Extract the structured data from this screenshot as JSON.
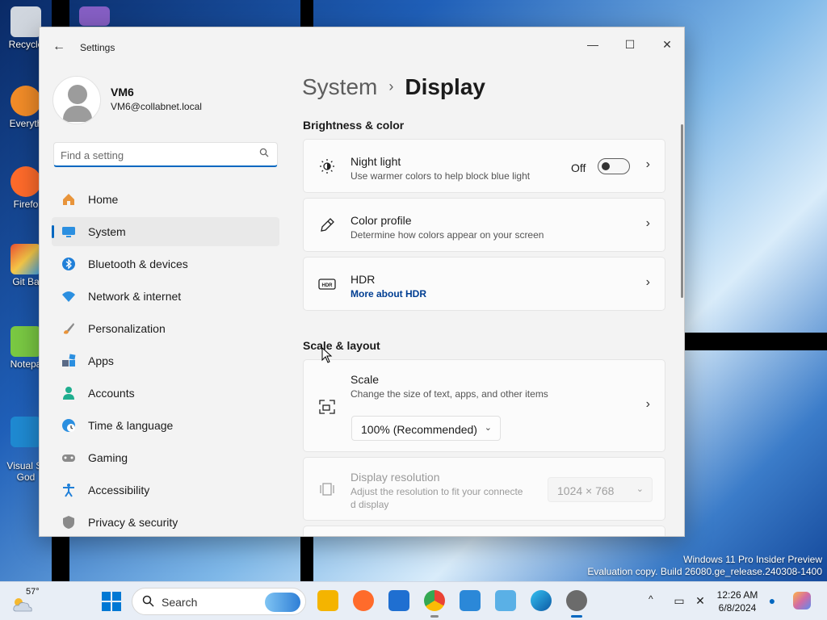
{
  "window": {
    "title": "Settings",
    "back_glyph": "←",
    "minimize_glyph": "—",
    "maximize_glyph": "☐",
    "close_glyph": "✕"
  },
  "profile": {
    "name": "VM6",
    "email": "VM6@collabnet.local"
  },
  "search": {
    "placeholder": "Find a setting",
    "icon": "search-icon"
  },
  "nav": {
    "items": [
      {
        "label": "Home",
        "icon": "home-icon"
      },
      {
        "label": "System",
        "icon": "system-icon",
        "active": true
      },
      {
        "label": "Bluetooth & devices",
        "icon": "bluetooth-icon"
      },
      {
        "label": "Network & internet",
        "icon": "wifi-icon"
      },
      {
        "label": "Personalization",
        "icon": "brush-icon"
      },
      {
        "label": "Apps",
        "icon": "apps-icon"
      },
      {
        "label": "Accounts",
        "icon": "account-icon"
      },
      {
        "label": "Time & language",
        "icon": "globe-clock-icon"
      },
      {
        "label": "Gaming",
        "icon": "controller-icon"
      },
      {
        "label": "Accessibility",
        "icon": "accessibility-icon"
      },
      {
        "label": "Privacy & security",
        "icon": "shield-icon"
      }
    ]
  },
  "breadcrumb": {
    "parent": "System",
    "separator": "›",
    "current": "Display"
  },
  "sections": {
    "brightness": "Brightness & color",
    "scale_layout": "Scale & layout"
  },
  "cards": {
    "night_light": {
      "title": "Night light",
      "subtitle": "Use warmer colors to help block blue light",
      "toggle_label": "Off",
      "toggle_on": false
    },
    "color_profile": {
      "title": "Color profile",
      "subtitle": "Determine how colors appear on your screen"
    },
    "hdr": {
      "title": "HDR",
      "link": "More about HDR"
    },
    "scale": {
      "title": "Scale",
      "subtitle": "Change the size of text, apps, and other items",
      "value": "100% (Recommended)"
    },
    "resolution": {
      "title": "Display resolution",
      "subtitle_line1": "Adjust the resolution to fit your connecte",
      "subtitle_line2": "d display",
      "value": "1024 × 768"
    }
  },
  "chevron": "›",
  "dropdown_chevron": "⌄",
  "desktop": {
    "icons": [
      {
        "label": "Recycle",
        "icon": "recycle-bin-icon",
        "color": "#d0d6de"
      },
      {
        "label": "Everyth",
        "icon": "everything-search-icon",
        "color": "#f28c28"
      },
      {
        "label": "Firefo",
        "icon": "firefox-icon",
        "color": "#ff6b2b"
      },
      {
        "label": "Git Ba",
        "icon": "git-bash-icon",
        "color": "#e84e31"
      },
      {
        "label": "Notepa",
        "icon": "notepad-icon",
        "color": "#7ac943"
      },
      {
        "label": "Visual St\nGod",
        "icon": "vscode-icon",
        "color": "#1f8ad2"
      }
    ],
    "watermark_line1": "Windows 11 Pro Insider Preview",
    "watermark_line2": "Evaluation copy. Build 26080.ge_release.240308-1400"
  },
  "taskbar": {
    "weather_temp": "57°",
    "search_label": "Search",
    "apps": [
      {
        "icon": "file-explorer-icon",
        "color": "#f4b400"
      },
      {
        "icon": "firefox-icon",
        "color": "#ff6b2b"
      },
      {
        "icon": "store-icon",
        "color": "#1f6fd1"
      },
      {
        "icon": "chrome-icon",
        "color": "#34a853"
      },
      {
        "icon": "photos-icon",
        "color": "#2b88d8"
      },
      {
        "icon": "snipping-tool-icon",
        "color": "#5ab0e6"
      },
      {
        "icon": "edge-icon",
        "color": "#0f8ad6"
      },
      {
        "icon": "settings-gear-icon",
        "color": "#6b6b6b"
      }
    ],
    "tray_chevron": "^",
    "time": "12:26 AM",
    "date": "6/8/2024"
  },
  "colors": {
    "accent": "#0067c0",
    "link": "#003e92"
  }
}
